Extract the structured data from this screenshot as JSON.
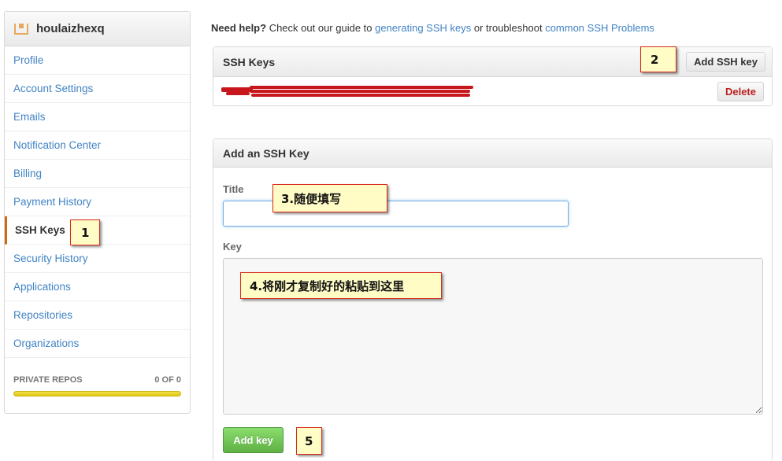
{
  "sidebar": {
    "username": "houlaizhexq",
    "items": [
      {
        "label": "Profile"
      },
      {
        "label": "Account Settings"
      },
      {
        "label": "Emails"
      },
      {
        "label": "Notification Center"
      },
      {
        "label": "Billing"
      },
      {
        "label": "Payment History"
      },
      {
        "label": "SSH Keys"
      },
      {
        "label": "Security History"
      },
      {
        "label": "Applications"
      },
      {
        "label": "Repositories"
      },
      {
        "label": "Organizations"
      }
    ],
    "selected_index": 6,
    "private_repos": {
      "label": "PRIVATE REPOS",
      "count": "0 OF 0"
    }
  },
  "help": {
    "lead": "Need help?",
    "text1": " Check out our guide to ",
    "link1": "generating SSH keys",
    "text2": " or troubleshoot ",
    "link2": "common SSH Problems"
  },
  "ssh_keys": {
    "title": "SSH Keys",
    "add_button": "Add SSH key",
    "delete_button": "Delete"
  },
  "add_key": {
    "title": "Add an SSH Key",
    "title_label": "Title",
    "title_value": "",
    "key_label": "Key",
    "key_value": "",
    "submit": "Add key"
  },
  "annotations": {
    "a1": "1",
    "a2": "2",
    "a3": "3.随便填写",
    "a4": "4.将刚才复制好的粘贴到这里",
    "a5": "5"
  },
  "colors": {
    "link": "#4183c4",
    "selected_accent": "#d26911",
    "add_button": "#60b044",
    "callout_bg": "#fffcc6",
    "callout_border": "#d92a1c",
    "redaction": "#c8161d"
  }
}
